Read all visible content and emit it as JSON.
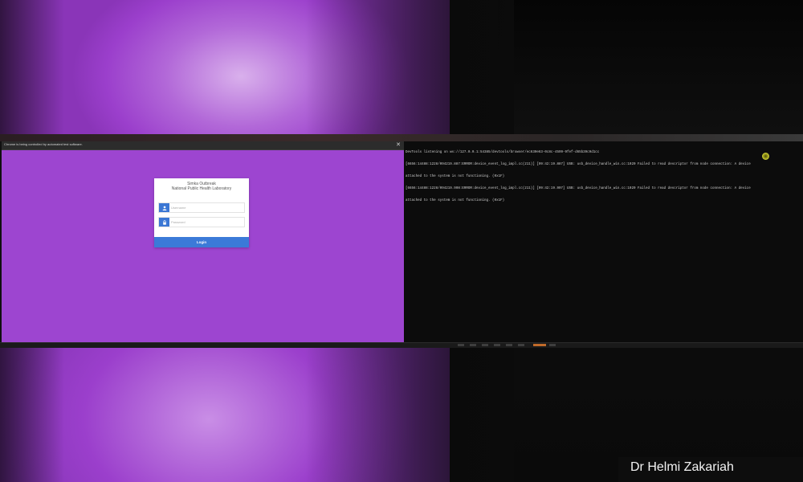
{
  "browser": {
    "infobar_text": "Chrome is being controlled by automated test software.",
    "close_glyph": "✕"
  },
  "login": {
    "title": "Simka Outbreak",
    "subtitle": "National Public Health Laboratory",
    "username_placeholder": "Username",
    "password_placeholder": "Password",
    "button_label": "Login",
    "accent_color": "#3b7ad8",
    "user_icon": "user-icon",
    "lock_icon": "lock-icon"
  },
  "console": {
    "lines": [
      "DevTools listening on ws://127.0.0.1:54385/devtools/browser/ec630e63-0c8c-4599-9fef-d65b39c9d1cc",
      "[6656:14488:1228/094219.887:ERROR:device_event_log_impl.cc(211)] [09:42:19.887] USB: usb_device_handle_win.cc:1020 Failed to read descriptor from node connection: A device",
      "attached to the system is not functioning. (0x1F)",
      "[6656:14488:1228/094219.908:ERROR:device_event_log_impl.cc(211)] [09:42:19.907] USB: usb_device_handle_win.cc:1020 Failed to read descriptor from node connection: A device",
      "attached to the system is not functioning. (0x1F)"
    ]
  },
  "credit": {
    "text": "Dr Helmi Zakariah"
  },
  "colors": {
    "page_purple": "#9d45d0",
    "console_bg": "#0c0c0c",
    "cursor_highlight": "#cfd23a"
  }
}
